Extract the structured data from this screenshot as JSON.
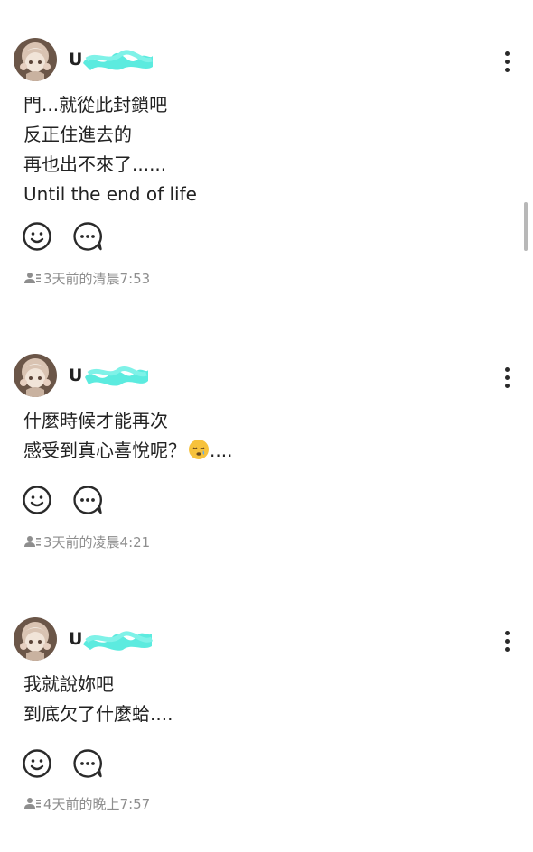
{
  "posts": [
    {
      "username": "U",
      "lines": [
        "門...就從此封鎖吧",
        "反正住進去的",
        "再也出不來了......",
        "Until the end of life"
      ],
      "timestamp": "3天前的清晨7:53"
    },
    {
      "username": "U",
      "lines": [
        "什麼時候才能再次",
        "感受到真心喜悅呢？"
      ],
      "trailing_emoji": "😪",
      "trailing_text": "....",
      "timestamp": "3天前的凌晨4:21"
    },
    {
      "username": "U",
      "lines": [
        "我就說妳吧",
        "到底欠了什麼蛤...."
      ],
      "timestamp": "4天前的晚上7:57"
    }
  ],
  "icons": {
    "more": "more-vertical-icon",
    "react": "smiley-icon",
    "comment": "comment-bubble-icon",
    "audience": "friends-icon"
  },
  "colors": {
    "text": "#222222",
    "meta": "#8e8e8e",
    "name_mask": "#3fe7d9",
    "icon": "#2a2a2a"
  }
}
